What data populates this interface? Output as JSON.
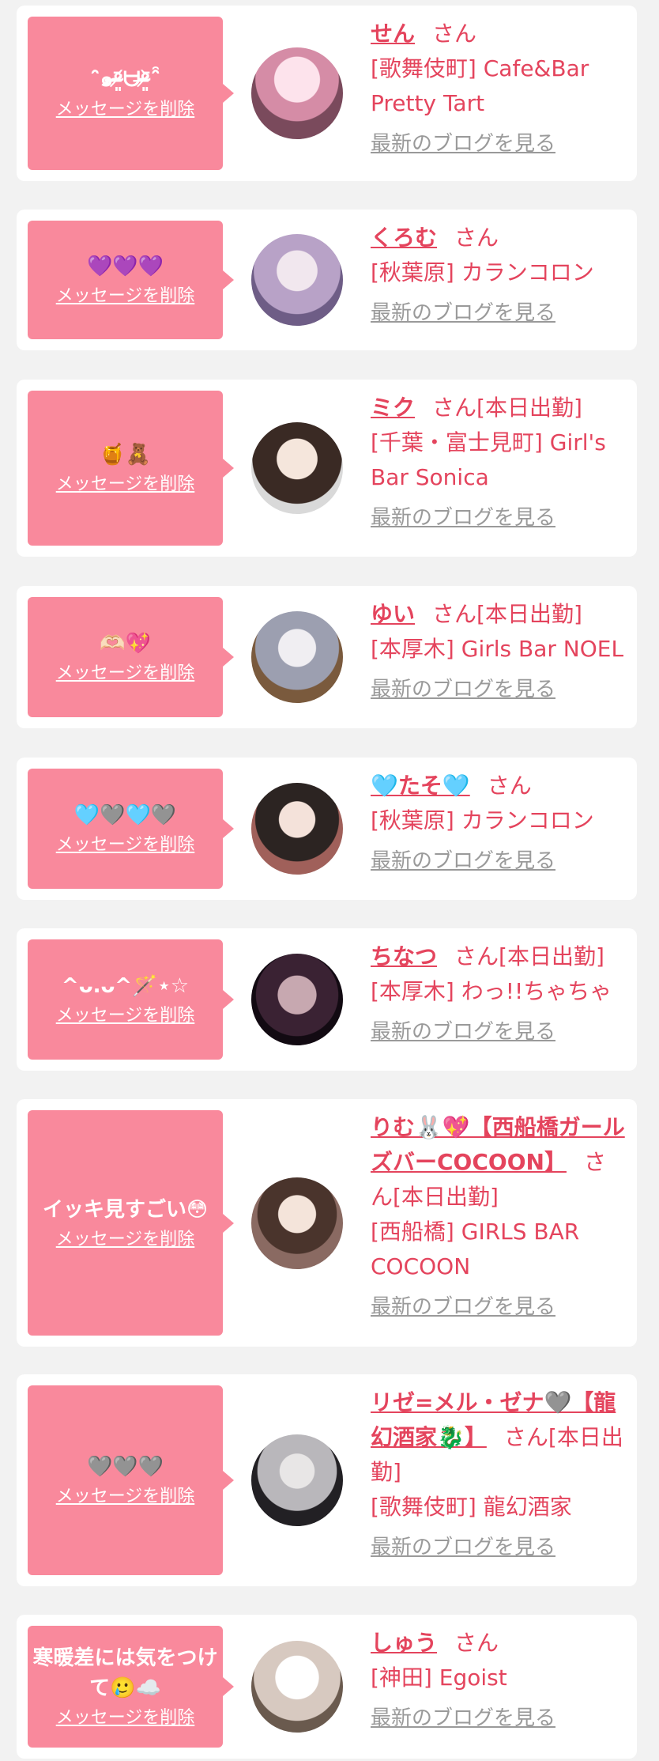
{
  "delete_label": "メッセージを削除",
  "blog_label": "最新のブログを見る",
  "colors": {
    "page_background": "#f2f2f2",
    "card_background": "#ffffff",
    "bubble_pink": "#f9899c",
    "name_text": "#e4445d",
    "blog_link_gray": "#9a9a9a"
  },
  "entries": [
    {
      "message": "ˆ̑̑๑ᵒ̴̶̷͈᷄ᗨᵒ̴̶̷͈᷅ˆ̑̑",
      "name": "せん",
      "honorific": "さん",
      "status": "",
      "shop_line": "[歌舞伎町] Cafe&Bar Pretty Tart",
      "avatar": "profile-photo"
    },
    {
      "message": "💜💜💜",
      "name": "くろむ",
      "honorific": "さん",
      "status": "",
      "shop_line": "[秋葉原] カランコロン",
      "avatar": "profile-photo"
    },
    {
      "message": "🍯🧸",
      "name": "ミク",
      "honorific": "さん",
      "status": "[本日出勤]",
      "shop_line": "[千葉・富士見町] Girl's Bar Sonica",
      "avatar": "profile-photo"
    },
    {
      "message": "🫶🏻💖",
      "name": "ゆい",
      "honorific": "さん",
      "status": "[本日出勤]",
      "shop_line": "[本厚木] Girls Bar NOEL",
      "avatar": "profile-photo"
    },
    {
      "message": "🩵🩶🩵🩶",
      "name": "🩵たそ🩵",
      "honorific": "さん",
      "status": "",
      "shop_line": "[秋葉原] カランコロン",
      "avatar": "profile-photo"
    },
    {
      "message": "^ᴗ.ᴗ^🪄⋆☆",
      "name": "ちなつ",
      "honorific": "さん",
      "status": "[本日出勤]",
      "shop_line": "[本厚木] わっ!!ちゃちゃ",
      "avatar": "profile-photo"
    },
    {
      "message": "イッキ見すごい😳",
      "name": "りむ🐰💖【西船橋ガールズバーCOCOON】",
      "honorific": "さん",
      "status": "[本日出勤]",
      "shop_line": "[西船橋] GIRLS BAR COCOON",
      "avatar": "profile-photo"
    },
    {
      "message": "🩶🩶🩶",
      "name": "リゼ=メル・ゼナ🩶【龍幻酒家🐉】",
      "honorific": "さん",
      "status": "[本日出勤]",
      "shop_line": "[歌舞伎町] 龍幻酒家",
      "avatar": "profile-photo"
    },
    {
      "message": "寒暖差には気をつけて🥲☁️",
      "name": "しゅう",
      "honorific": "さん",
      "status": "",
      "shop_line": "[神田] Egoist",
      "avatar": "profile-photo"
    }
  ]
}
